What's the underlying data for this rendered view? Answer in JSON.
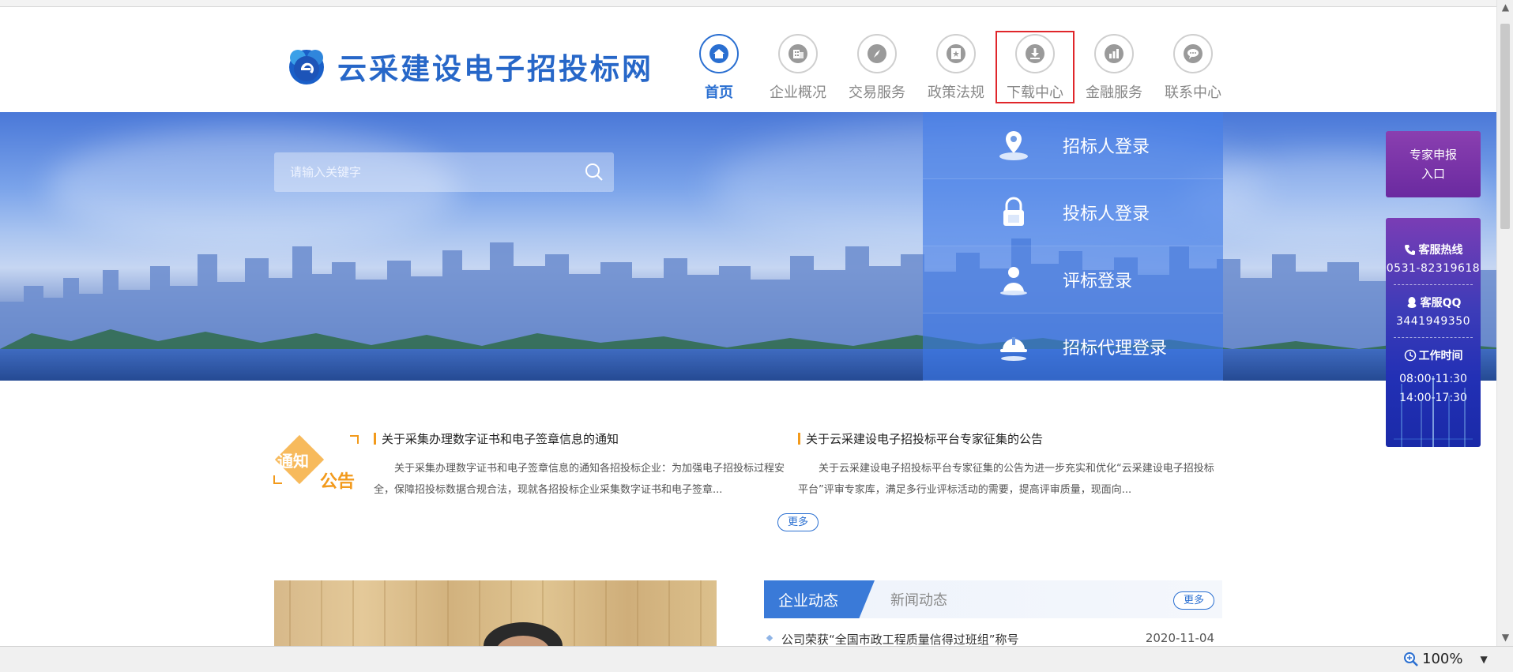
{
  "site": {
    "logo_text": "云采建设电子招投标网"
  },
  "nav": {
    "items": [
      {
        "label": "首页",
        "icon": "home-icon"
      },
      {
        "label": "企业概况",
        "icon": "building-icon"
      },
      {
        "label": "交易服务",
        "icon": "compass-icon"
      },
      {
        "label": "政策法规",
        "icon": "document-star-icon"
      },
      {
        "label": "下载中心",
        "icon": "download-icon"
      },
      {
        "label": "金融服务",
        "icon": "bar-chart-icon"
      },
      {
        "label": "联系中心",
        "icon": "chat-icon"
      }
    ],
    "active_index": 0,
    "highlight_index": 4
  },
  "search": {
    "placeholder": "请输入关键字"
  },
  "login": {
    "items": [
      {
        "label": "招标人登录",
        "icon": "location-user-icon"
      },
      {
        "label": "投标人登录",
        "icon": "lock-icon"
      },
      {
        "label": "评标登录",
        "icon": "user-icon"
      },
      {
        "label": "招标代理登录",
        "icon": "helmet-icon"
      }
    ]
  },
  "expert": {
    "line1": "专家申报",
    "line2": "入口"
  },
  "service": {
    "hotline_title": "客服热线",
    "hotline_value": "0531-82319618",
    "qq_title": "客服QQ",
    "qq_value": "3441949350",
    "hours_title": "工作时间",
    "hours_am": "08:00-11:30",
    "hours_pm": "14:00-17:30"
  },
  "notice": {
    "emblem_line1": "通知",
    "emblem_line2": "公告",
    "items": [
      {
        "title": "关于采集办理数字证书和电子签章信息的通知",
        "body": "关于采集办理数字证书和电子签章信息的通知各招投标企业：为加强电子招投标过程安全，保障招投标数据合规合法，现就各招投标企业采集数字证书和电子签章..."
      },
      {
        "title": "关于云采建设电子招投标平台专家征集的公告",
        "body": "关于云采建设电子招投标平台专家征集的公告为进一步充实和优化“云采建设电子招投标平台”评审专家库，满足多行业评标活动的需要，提高评审质量，现面向..."
      }
    ],
    "more_label": "更多"
  },
  "news": {
    "tab_active": "企业动态",
    "tab_inactive": "新闻动态",
    "more_label": "更多",
    "items": [
      {
        "title": "公司荣获“全国市政工程质量信得过班组”称号",
        "date": "2020-11-04"
      }
    ]
  },
  "statusbar": {
    "zoom": "100%"
  },
  "colors": {
    "brand": "#2767c8",
    "accent": "#2a6fd1",
    "highlight": "#e0262b",
    "notice_orange": "#f29a1c"
  }
}
